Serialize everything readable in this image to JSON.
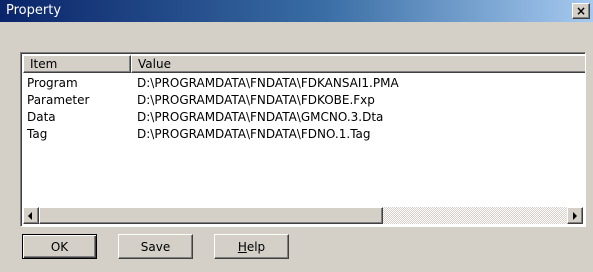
{
  "window": {
    "title": "Property",
    "close_glyph": "×"
  },
  "list": {
    "columns": {
      "item": "Item",
      "value": "Value"
    },
    "rows": [
      {
        "item": "Program",
        "value": "D:\\PROGRAMDATA\\FNDATA\\FDKANSAI1.PMA"
      },
      {
        "item": "Parameter",
        "value": "D:\\PROGRAMDATA\\FNDATA\\FDKOBE.Fxp"
      },
      {
        "item": "Data",
        "value": "D:\\PROGRAMDATA\\FNDATA\\GMCNO.3.Dta"
      },
      {
        "item": "Tag",
        "value": "D:\\PROGRAMDATA\\FNDATA\\FDNO.1.Tag"
      }
    ]
  },
  "buttons": {
    "ok": "OK",
    "save": "Save",
    "help_mnemonic": "H",
    "help_rest": "elp"
  }
}
